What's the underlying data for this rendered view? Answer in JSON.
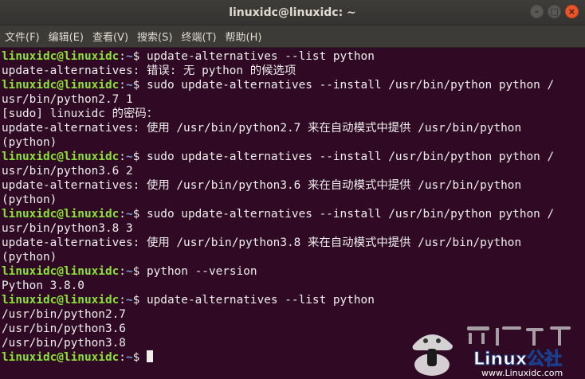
{
  "window": {
    "title": "linuxidc@linuxidc: ~"
  },
  "menu": {
    "items": [
      "文件(F)",
      "编辑(E)",
      "查看(V)",
      "搜索(S)",
      "终端(T)",
      "帮助(H)"
    ]
  },
  "prompt": {
    "user_host": "linuxidc@linuxidc",
    "sep": ":",
    "dir": "~",
    "sign": "$ "
  },
  "terminal": {
    "lines": [
      {
        "type": "prompt",
        "text": "update-alternatives --list python"
      },
      {
        "type": "output",
        "text": "update-alternatives: 错误: 无 python 的候选项"
      },
      {
        "type": "prompt",
        "text": "sudo update-alternatives --install /usr/bin/python python /"
      },
      {
        "type": "output",
        "text": "usr/bin/python2.7 1"
      },
      {
        "type": "output",
        "text": "[sudo] linuxidc 的密码："
      },
      {
        "type": "output",
        "text": "update-alternatives: 使用 /usr/bin/python2.7 来在自动模式中提供 /usr/bin/python"
      },
      {
        "type": "output",
        "text": "(python)"
      },
      {
        "type": "prompt",
        "text": "sudo update-alternatives --install /usr/bin/python python /"
      },
      {
        "type": "output",
        "text": "usr/bin/python3.6 2"
      },
      {
        "type": "output",
        "text": "update-alternatives: 使用 /usr/bin/python3.6 来在自动模式中提供 /usr/bin/python"
      },
      {
        "type": "output",
        "text": "(python)"
      },
      {
        "type": "prompt",
        "text": "sudo update-alternatives --install /usr/bin/python python /"
      },
      {
        "type": "output",
        "text": "usr/bin/python3.8 3"
      },
      {
        "type": "output",
        "text": "update-alternatives: 使用 /usr/bin/python3.8 来在自动模式中提供 /usr/bin/python"
      },
      {
        "type": "output",
        "text": "(python)"
      },
      {
        "type": "prompt",
        "text": "python --version"
      },
      {
        "type": "output",
        "text": "Python 3.8.0"
      },
      {
        "type": "prompt",
        "text": "update-alternatives --list python"
      },
      {
        "type": "output",
        "text": "/usr/bin/python2.7"
      },
      {
        "type": "output",
        "text": "/usr/bin/python3.6"
      },
      {
        "type": "output",
        "text": "/usr/bin/python3.8"
      },
      {
        "type": "prompt",
        "text": "",
        "cursor": true
      }
    ]
  },
  "watermark": {
    "title": "Linux公社",
    "url": "www.Linuxidc.com"
  },
  "colors": {
    "background": "#300a24",
    "prompt_user": "#8ae234",
    "prompt_dir": "#729fcf",
    "text": "#eeeeec",
    "close_button": "#e9552a"
  }
}
